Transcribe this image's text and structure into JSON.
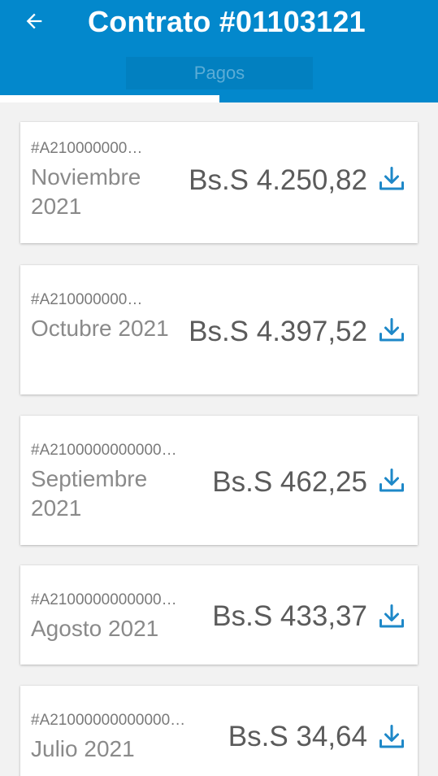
{
  "header": {
    "title": "Contrato #01103121",
    "tab_active": "Pagos",
    "color": "#0388cc"
  },
  "items": [
    {
      "id": "#A210000000…",
      "period": "Noviembre 2021",
      "amount": "Bs.S 4.250,82"
    },
    {
      "id": "#A210000000…",
      "period": "Octubre 2021",
      "amount": "Bs.S 4.397,52"
    },
    {
      "id": "#A2100000000000…",
      "period": "Septiembre 2021",
      "amount": "Bs.S 462,25"
    },
    {
      "id": "#A2100000000000…",
      "period": "Agosto 2021",
      "amount": "Bs.S 433,37"
    },
    {
      "id": "#A21000000000000…",
      "period": "Julio 2021",
      "amount": "Bs.S 34,64"
    }
  ],
  "icons": {
    "back": "arrow-left-icon",
    "download": "download-icon",
    "icon_color": "#1e88c8"
  }
}
